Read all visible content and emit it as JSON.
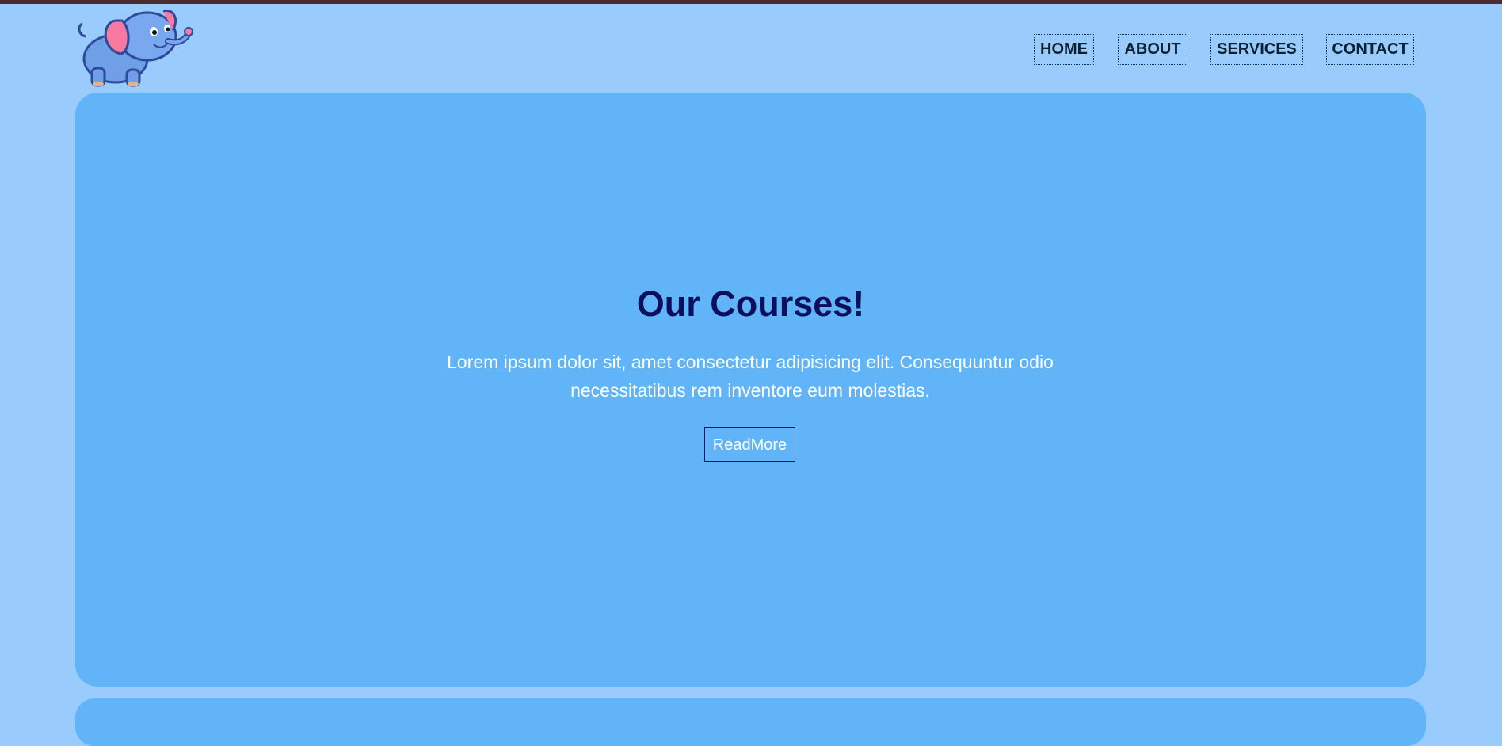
{
  "nav": {
    "items": [
      {
        "label": "HOME"
      },
      {
        "label": "ABOUT"
      },
      {
        "label": "SERVICES"
      },
      {
        "label": "CONTACT"
      }
    ]
  },
  "hero": {
    "title": "Our Courses!",
    "description": "Lorem ipsum dolor sit, amet consectetur adipisicing elit. Consequuntur odio necessitatibus rem inventore eum molestias.",
    "button_label": "ReadMore"
  },
  "logo": {
    "icon": "elephant-icon"
  },
  "colors": {
    "page_background": "#99ccfd",
    "hero_background": "#62b4f9",
    "title_color": "#0d0f5c",
    "top_strip": "#4a2d33"
  }
}
